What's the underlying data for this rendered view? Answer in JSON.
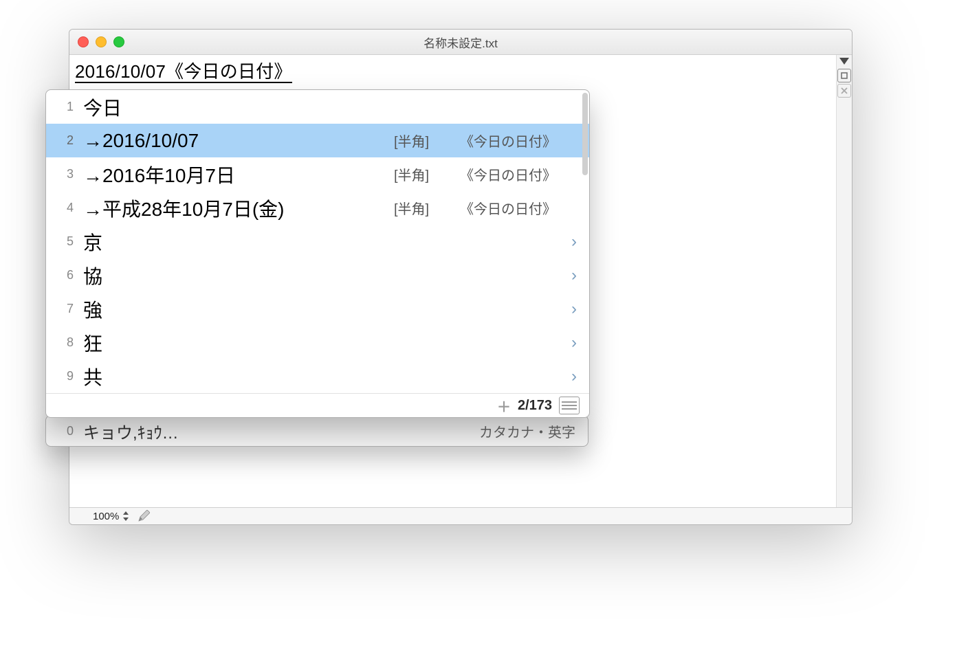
{
  "titlebar": {
    "title": "名称未設定.txt"
  },
  "editor": {
    "composing_text": "2016/10/07《今日の日付》"
  },
  "ime": {
    "candidates": [
      {
        "n": "1",
        "text": "今日",
        "tag1": "",
        "tag2": "",
        "has_more": false
      },
      {
        "n": "2",
        "text": "→2016/10/07",
        "tag1": "[半角]",
        "tag2": "《今日の日付》",
        "has_more": false,
        "selected": true
      },
      {
        "n": "3",
        "text": "→2016年10月7日",
        "tag1": "[半角]",
        "tag2": "《今日の日付》",
        "has_more": false
      },
      {
        "n": "4",
        "text": "→平成28年10月7日(金)",
        "tag1": "[半角]",
        "tag2": "《今日の日付》",
        "has_more": false
      },
      {
        "n": "5",
        "text": "京",
        "tag1": "",
        "tag2": "",
        "has_more": true
      },
      {
        "n": "6",
        "text": "協",
        "tag1": "",
        "tag2": "",
        "has_more": true
      },
      {
        "n": "7",
        "text": "強",
        "tag1": "",
        "tag2": "",
        "has_more": true
      },
      {
        "n": "8",
        "text": "狂",
        "tag1": "",
        "tag2": "",
        "has_more": true
      },
      {
        "n": "9",
        "text": "共",
        "tag1": "",
        "tag2": "",
        "has_more": true
      }
    ],
    "count": "2/173"
  },
  "ime_mode": {
    "n": "0",
    "text": "キョウ,ｷｮｳ…",
    "right": "カタカナ・英字"
  },
  "statusbar": {
    "zoom": "100%"
  }
}
